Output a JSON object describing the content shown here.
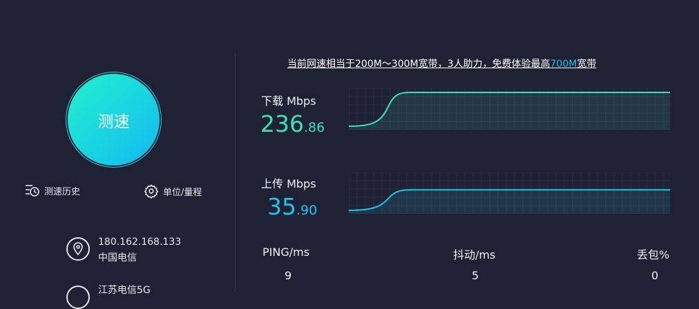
{
  "speed_button": {
    "label": "测速"
  },
  "tools": {
    "history": "测速历史",
    "unit": "单位/量程"
  },
  "network": {
    "ip": "180.162.168.133",
    "isp": "中国电信",
    "node": "江苏电信5G"
  },
  "banner": {
    "prefix": "当前网速相当于200M～300M宽带，3人助力，免费体验最高",
    "highlight": "700M",
    "suffix": "宽带"
  },
  "download": {
    "label": "下载 Mbps",
    "int": "236",
    "dec": ".86",
    "color": "#3ee1b5",
    "fraction": 0.9
  },
  "upload": {
    "label": "上传 Mbps",
    "int": "35",
    "dec": ".90",
    "color": "#1ec4ea",
    "fraction": 0.58
  },
  "stats": {
    "ping_label": "PING/ms",
    "ping_value": "9",
    "jitter_label": "抖动/ms",
    "jitter_value": "5",
    "loss_label": "丢包%",
    "loss_value": "0"
  }
}
